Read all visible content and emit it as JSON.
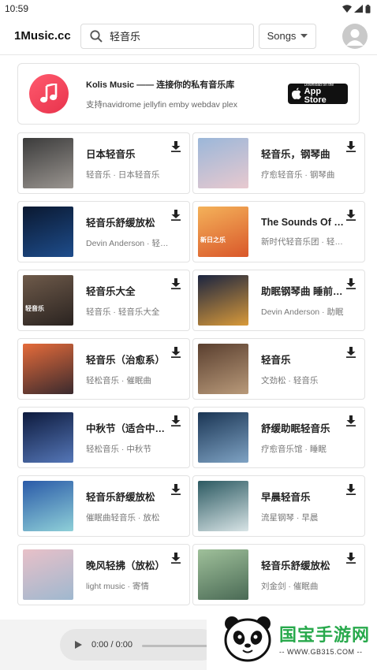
{
  "status": {
    "time": "10:59"
  },
  "header": {
    "app_title": "1Music.cc",
    "search_value": "轻音乐",
    "search_placeholder": "",
    "type_selected": "Songs"
  },
  "promo": {
    "title": "Kolis Music —— 连接你的私有音乐库",
    "subtitle": "支持navidrome jellyfin emby webdav plex",
    "store_small": "Download on the",
    "store_big": "App Store"
  },
  "songs": [
    {
      "title": "日本轻音乐",
      "sub": "轻音乐 · 日本轻音乐",
      "cover_a": "#3b3b3b",
      "cover_b": "#9a9590"
    },
    {
      "title": "轻音乐，钢琴曲",
      "sub": "疗愈轻音乐 · 钢琴曲",
      "cover_a": "#9bb7d9",
      "cover_b": "#e8c9cf"
    },
    {
      "title": "轻音乐舒缓放松",
      "sub": "Devin Anderson · 轻音乐",
      "cover_a": "#0a1830",
      "cover_b": "#1e4d8c"
    },
    {
      "title": "The Sounds Of Silence",
      "sub": "新时代轻音乐团 · 轻音乐",
      "cover_a": "#f4b25a",
      "cover_b": "#d9572a",
      "cover_caption": "新日之乐"
    },
    {
      "title": "轻音乐大全",
      "sub": "轻音乐 · 轻音乐大全",
      "cover_a": "#6e5a4a",
      "cover_b": "#2a2320",
      "cover_caption": "轻音乐"
    },
    {
      "title": "助眠钢琴曲 睡前轻音乐",
      "sub": "Devin Anderson · 助眠",
      "cover_a": "#1b2440",
      "cover_b": "#d99a3a"
    },
    {
      "title": "轻音乐（治愈系）",
      "sub": "轻松音乐 · 催眠曲",
      "cover_a": "#e56b3a",
      "cover_b": "#3a2a2e"
    },
    {
      "title": "轻音乐",
      "sub": "文劲松 · 轻音乐",
      "cover_a": "#5a3f2f",
      "cover_b": "#b99a7a"
    },
    {
      "title": "中秋节（适合中秋）",
      "sub": "轻松音乐 · 中秋节",
      "cover_a": "#0d1a3d",
      "cover_b": "#5577b8"
    },
    {
      "title": "舒缓助眠轻音乐",
      "sub": "疗愈音乐馆 · 睡眠",
      "cover_a": "#1a3554",
      "cover_b": "#7fa3c4"
    },
    {
      "title": "轻音乐舒缓放松",
      "sub": "催眠曲轻音乐 · 放松",
      "cover_a": "#2a5aa8",
      "cover_b": "#8fd0d8"
    },
    {
      "title": "早晨轻音乐",
      "sub": "流星钢琴 · 早晨",
      "cover_a": "#2c5a62",
      "cover_b": "#d8e4e6"
    },
    {
      "title": "晚风轻拂（放松）",
      "sub": "light music · 寄情",
      "cover_a": "#e8c0c8",
      "cover_b": "#9fb8cf"
    },
    {
      "title": "轻音乐舒缓放松",
      "sub": "刘金剑 · 催眠曲",
      "cover_a": "#9fc09a",
      "cover_b": "#4a6a55"
    }
  ],
  "player": {
    "time": "0:00 / 0:00"
  },
  "watermark": {
    "brand": "国宝手游网",
    "url": "-- WWW.GB315.COM --"
  },
  "colors": {
    "accent_red": "#e8334c",
    "watermark_green": "#28a94c"
  },
  "icons": [
    "wifi-icon",
    "signal-icon",
    "battery-icon",
    "search-icon",
    "caret-down-icon",
    "user-avatar-icon",
    "music-note-icon",
    "apple-icon",
    "download-icon",
    "play-icon",
    "panda-icon"
  ]
}
